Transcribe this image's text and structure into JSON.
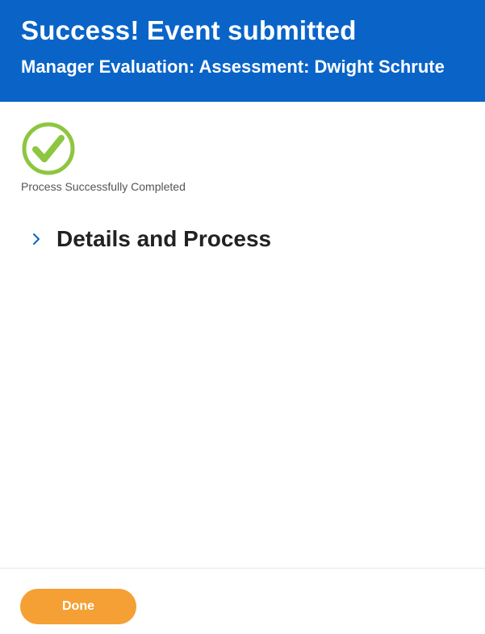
{
  "header": {
    "title": "Success! Event submitted",
    "subtitle": "Manager Evaluation: Assessment: Dwight Schrute",
    "background_color": "#0a64c8"
  },
  "status": {
    "icon": "check-circle-icon",
    "icon_color": "#8dc63f",
    "label": "Process Successfully Completed"
  },
  "details": {
    "icon": "chevron-right-icon",
    "title": "Details and Process",
    "expanded": false
  },
  "footer": {
    "done_label": "Done",
    "done_color": "#f5a034"
  }
}
